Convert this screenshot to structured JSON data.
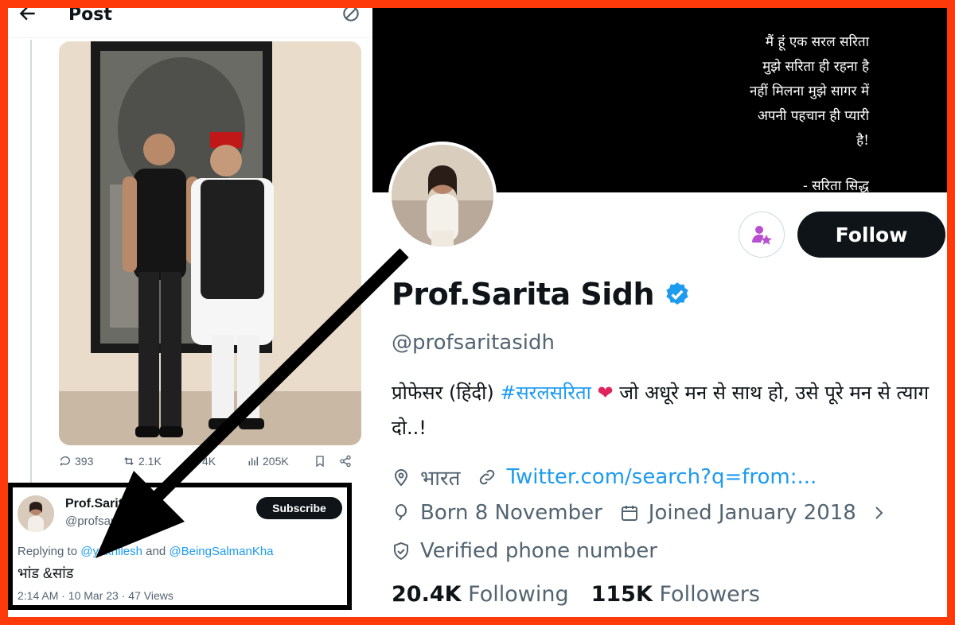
{
  "post_panel": {
    "title": "Post",
    "stats": {
      "replies": "393",
      "reposts": "2.1K",
      "likes": "4K",
      "views": "205K"
    },
    "reply": {
      "name": "Prof.Sarit",
      "handle": "@profsari",
      "subscribe_label": "Subscribe",
      "replying_prefix": "Replying to",
      "replying_user1": "@ya",
      "replying_user1_rest": "khilesh",
      "replying_and": "and",
      "replying_user2": "@BeingSalmanKha",
      "text": "भांड &सांड",
      "meta": "2:14 AM · 10 Mar 23 · 47 Views"
    }
  },
  "profile": {
    "banner_quote": [
      "मैं हूं एक सरल सरिता",
      "मुझे सरिता ही रहना है",
      "नहीं मिलना मुझे सागर में",
      "अपनी पहचान ही प्यारी",
      "है!"
    ],
    "banner_signature": "- सरिता सिद्ध",
    "follow_label": "Follow",
    "display_name": "Prof.Sarita Sidh",
    "handle": "@profsaritasidh",
    "bio_prefix": "प्रोफेसर (हिंदी) ",
    "bio_hashtag": "#सरलसरिता",
    "bio_heart": "❤",
    "bio_suffix": " जो अधूरे मन से साथ हो, उसे पूरे मन से त्याग दो..!",
    "location": "भारत",
    "website": "Twitter.com/search?q=from:...",
    "birthday": "Born 8 November",
    "joined": "Joined January 2018",
    "verified_phone": "Verified phone number",
    "following_count": "20.4K",
    "following_label": "Following",
    "followers_count": "115K",
    "followers_label": "Followers"
  },
  "colors": {
    "accent": "#1d9bf0",
    "border_frame": "#ff3a0a",
    "text_primary": "#0f1419",
    "text_secondary": "#536471"
  }
}
